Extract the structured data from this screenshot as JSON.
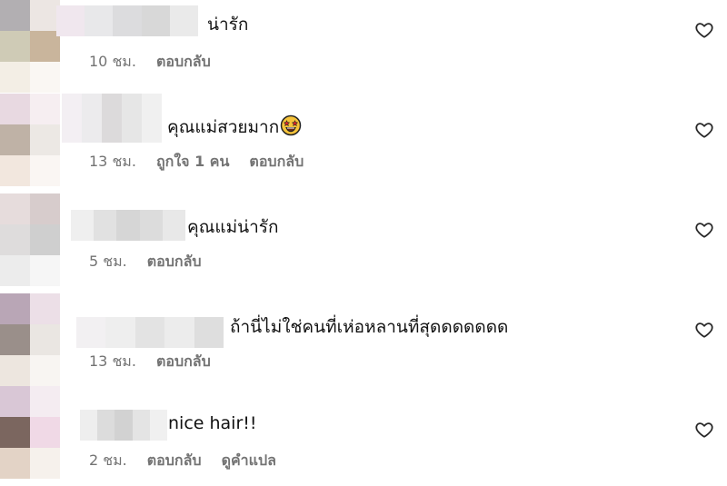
{
  "comments": [
    {
      "text": "น่ารัก",
      "meta": {
        "time": "10 ชม.",
        "likes": "",
        "reply": "ตอบกลับ",
        "translate": ""
      },
      "emoji": false,
      "avatar_colors": [
        "#d6d3cf",
        "#b2afb2",
        "#ece6e3",
        "#e8e4df",
        "#cfcbb6",
        "#c9b59c",
        "#f8f2e9",
        "#f3eee5",
        "#faf7f3",
        "#f4eee9"
      ],
      "name_blur_colors": [
        "#f0e7ee",
        "#e8e8ea",
        "#dcdcde",
        "#d8d8d8",
        "#eaeaea"
      ]
    },
    {
      "text": "คุณแม่สวยมาก",
      "meta": {
        "time": "13 ชม.",
        "likes": "ถูกใจ 1 คน",
        "reply": "ตอบกลับ",
        "translate": ""
      },
      "emoji": true,
      "avatar_colors": [
        "#f1e6e6",
        "#e8d9e1",
        "#f6eef1",
        "#d6d2c0",
        "#bfb2a6",
        "#ece8e4",
        "#f8f3ef",
        "#f2e7de",
        "#faf6f3"
      ],
      "name_blur_colors": [
        "#f3eff3",
        "#ecebed",
        "#dcdadb",
        "#e6e6e6",
        "#f0f0f0"
      ]
    },
    {
      "text": "คุณแม่น่ารัก",
      "meta": {
        "time": "5 ชม.",
        "likes": "",
        "reply": "ตอบกลับ",
        "translate": ""
      },
      "emoji": false,
      "avatar_colors": [
        "#f7f5f5",
        "#e6dcdc",
        "#d7cccc",
        "#efefef",
        "#dedcdc",
        "#cfcfcf",
        "#f4f4f4",
        "#ececec",
        "#f6f6f6"
      ],
      "name_blur_colors": [
        "#efefef",
        "#e1e1e1",
        "#d6d6d6",
        "#dcdcdc",
        "#e8e8e8"
      ]
    },
    {
      "text": "ถ้านี่ไม่ใช่คนที่เห่อหลานที่สุดดดดดดด",
      "meta": {
        "time": "13 ชม.",
        "likes": "",
        "reply": "ตอบกลับ",
        "translate": ""
      },
      "emoji": false,
      "avatar_colors": [
        "#e7dedf",
        "#b9a6b6",
        "#ecdfe7",
        "#d9d5cf",
        "#9a8f8a",
        "#eae6e2",
        "#f4f1ee",
        "#ede6df",
        "#f8f5f2"
      ],
      "name_blur_colors": [
        "#f2f0f2",
        "#eeeeee",
        "#e3e3e3",
        "#ececec",
        "#dedede"
      ]
    },
    {
      "text": "nice hair!!",
      "meta": {
        "time": "2 ชม.",
        "likes": "",
        "reply": "ตอบกลับ",
        "translate": "ดูคำแปล"
      },
      "emoji": false,
      "avatar_colors": [
        "#efe5e4",
        "#d9c7d6",
        "#f4ecf1",
        "#b8a394",
        "#7b665f",
        "#f0d9e6",
        "#e7dfd8",
        "#e3d3c6",
        "#f6f1ec"
      ],
      "name_blur_colors": [
        "#eeeeee",
        "#dcdcdc",
        "#d2d2d2",
        "#e4e4e4",
        "#f0f0f0"
      ]
    }
  ],
  "icons": {
    "heart": "heart-outline-icon",
    "emoji": "star-struck-emoji-icon"
  },
  "colors": {
    "meta": "#737373",
    "text": "#111111",
    "heart": "#262626"
  }
}
